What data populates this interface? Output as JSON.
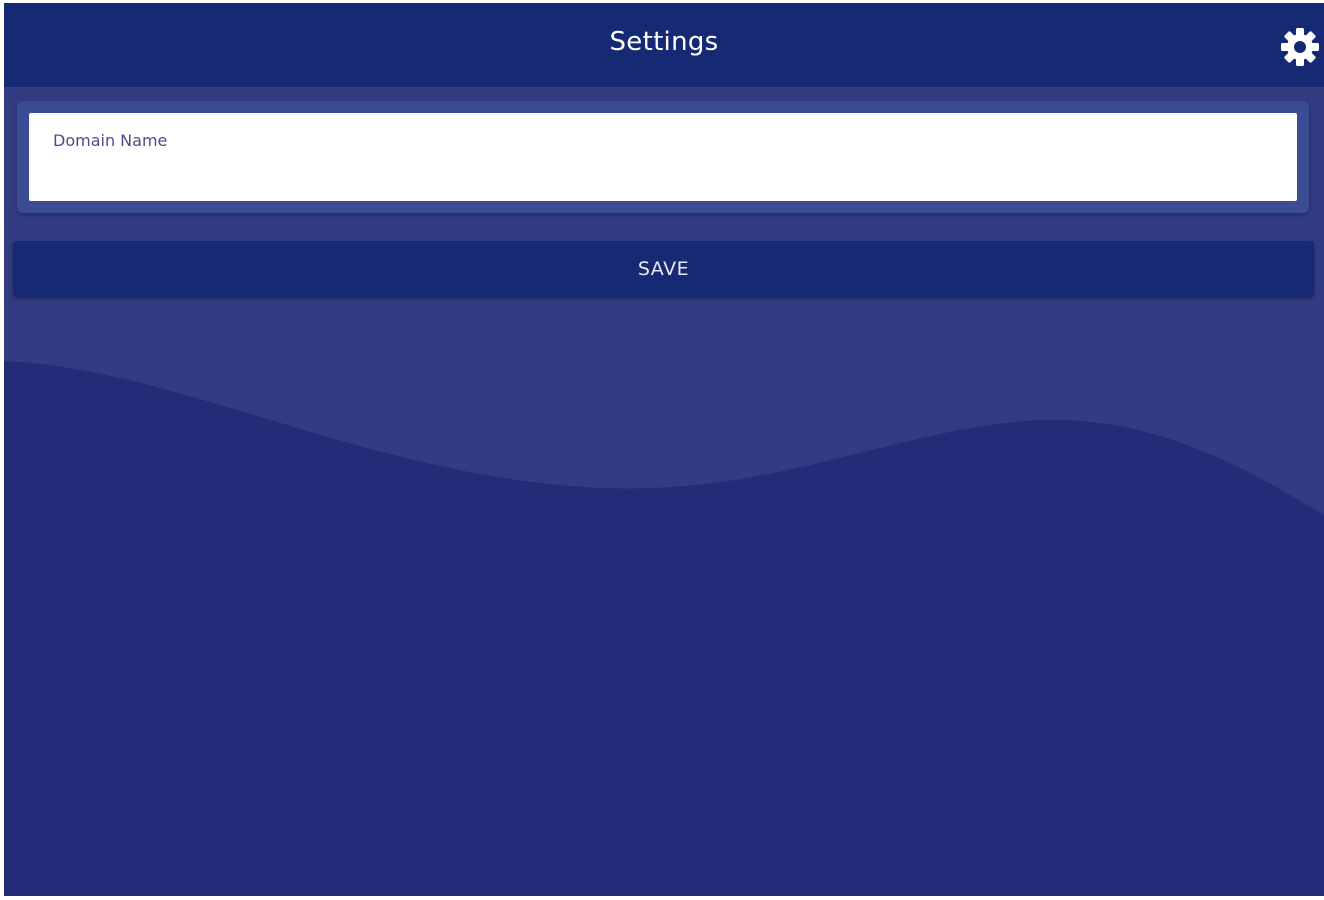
{
  "header": {
    "title": "Settings",
    "settings_icon": "gear-icon"
  },
  "form": {
    "domain_field": {
      "label": "Domain Name",
      "value": ""
    },
    "save_label": "SAVE"
  },
  "colors": {
    "header": "#162a73",
    "background": "#323c82",
    "wave": "#252c77",
    "panel": "#3a4d94",
    "button": "#162a73"
  }
}
